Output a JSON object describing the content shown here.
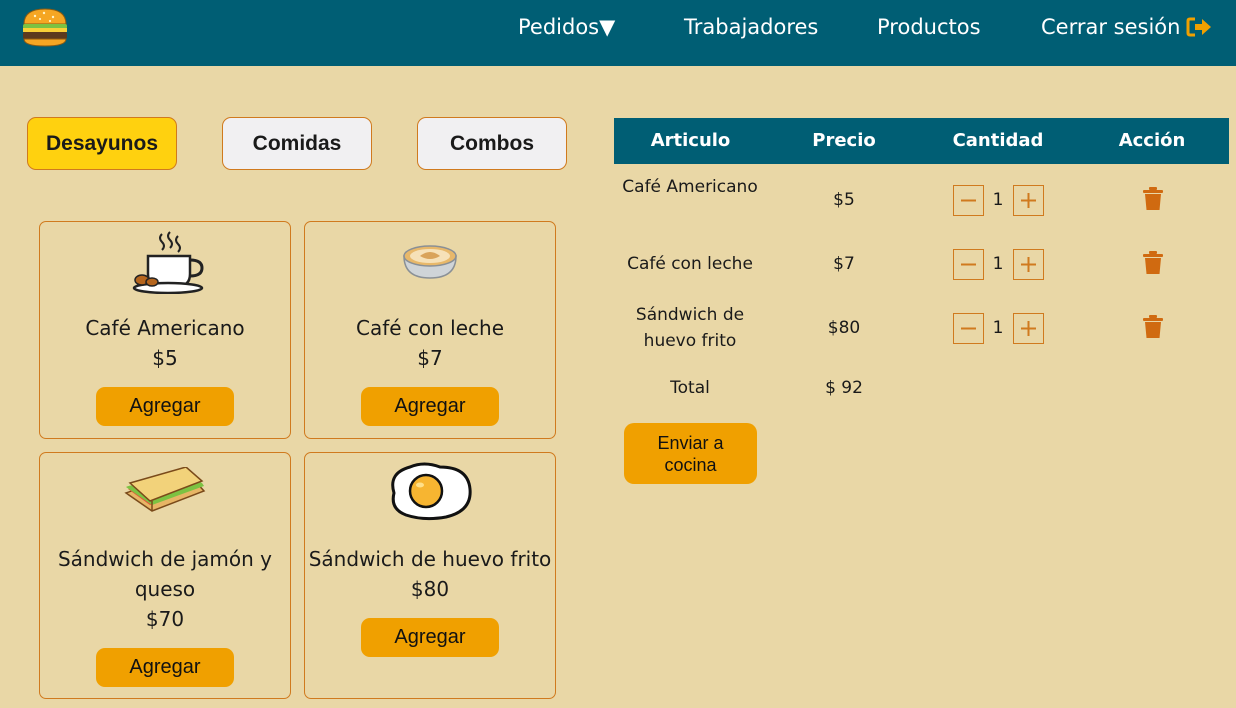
{
  "header": {
    "logo_icon": "burger-icon",
    "nav": {
      "pedidos": "Pedidos▼",
      "trabajadores": "Trabajadores",
      "productos": "Productos",
      "logout": "Cerrar sesión",
      "logout_icon": "sign-out-icon"
    }
  },
  "colors": {
    "header_bg": "#005E74",
    "page_bg": "#E9D7A6",
    "accent_orange": "#F0A000",
    "active_tab": "#FFD10F",
    "border": "#D07A1E"
  },
  "categories": [
    {
      "label": "Desayunos",
      "active": true
    },
    {
      "label": "Comidas",
      "active": false
    },
    {
      "label": "Combos",
      "active": false
    }
  ],
  "products": [
    {
      "name": "Café Americano",
      "price": "$5",
      "button": "Agregar",
      "icon": "coffee-cup-icon"
    },
    {
      "name": "Café con leche",
      "price": "$7",
      "button": "Agregar",
      "icon": "latte-icon"
    },
    {
      "name": "Sándwich de jamón y queso",
      "price": "$70",
      "button": "Agregar",
      "icon": "sandwich-icon"
    },
    {
      "name": "Sándwich de huevo frito",
      "price": "$80",
      "button": "Agregar",
      "icon": "fried-egg-icon"
    }
  ],
  "order": {
    "columns": [
      "Articulo",
      "Precio",
      "Cantidad",
      "Acción"
    ],
    "rows": [
      {
        "item": "Café Americano",
        "price": "$5",
        "qty": "1"
      },
      {
        "item": "Café con leche",
        "price": "$7",
        "qty": "1"
      },
      {
        "item": "Sándwich de huevo frito",
        "price": "$80",
        "qty": "1"
      }
    ],
    "total_label": "Total",
    "total_value": "$ 92",
    "send_button": "Enviar a cocina"
  }
}
